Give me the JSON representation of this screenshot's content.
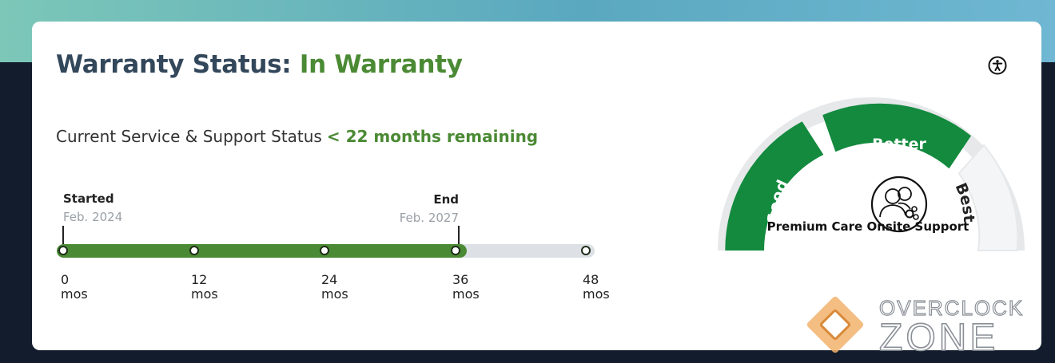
{
  "warranty": {
    "title_label": "Warranty Status:",
    "status": "In Warranty"
  },
  "support": {
    "label": "Current Service & Support Status",
    "remaining": "< 22 months remaining"
  },
  "timeline": {
    "start": {
      "label": "Started",
      "date": "Feb. 2024"
    },
    "end": {
      "label": "End",
      "date": "Feb. 2027"
    },
    "elapsed_months": 36,
    "total_months": 48,
    "ticks": [
      {
        "value": "0",
        "unit": "mos"
      },
      {
        "value": "12",
        "unit": "mos"
      },
      {
        "value": "24",
        "unit": "mos"
      },
      {
        "value": "36",
        "unit": "mos"
      },
      {
        "value": "48",
        "unit": "mos"
      }
    ]
  },
  "gauge": {
    "segments": [
      "Good",
      "Better",
      "Best"
    ],
    "active_level": "Better",
    "caption": "Premium Care Onsite Support",
    "icon": "support-people-gear-icon"
  },
  "watermark": {
    "line1": "OVERCLOCK",
    "line2": "ZONE"
  },
  "colors": {
    "accent_green": "#4b8a34",
    "title": "#33475b",
    "track": "#dde1e6"
  }
}
